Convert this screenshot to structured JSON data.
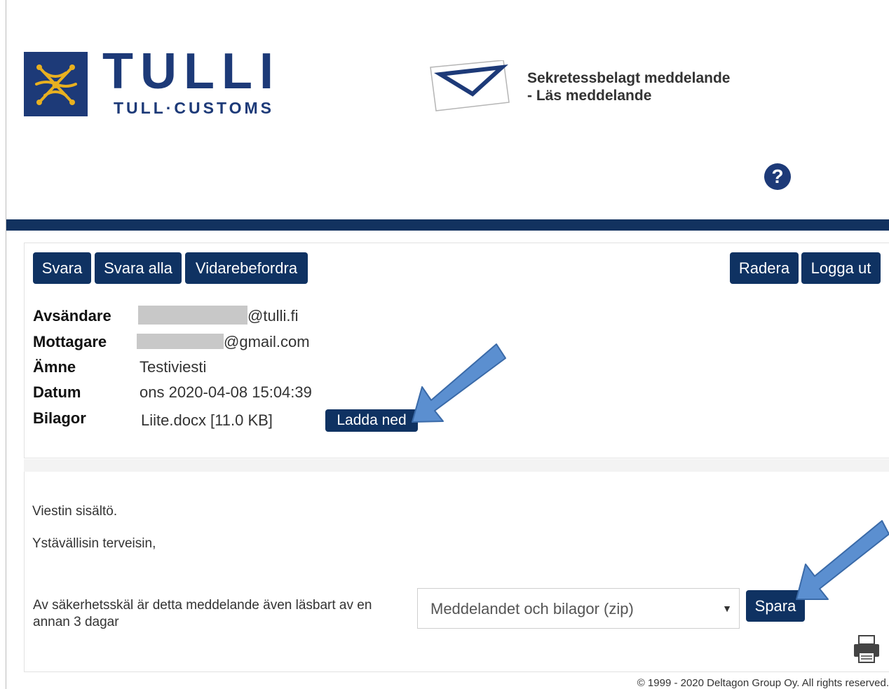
{
  "header": {
    "brand_title": "TULLI",
    "brand_subtitle": "TULL·CUSTOMS",
    "title_line1": "Sekretessbelagt meddelande",
    "title_line2": "- Läs meddelande",
    "help_label": "?"
  },
  "toolbar": {
    "reply": "Svara",
    "reply_all": "Svara alla",
    "forward": "Vidarebefordra",
    "delete": "Radera",
    "logout": "Logga ut"
  },
  "message": {
    "sender_label": "Avsändare",
    "sender_value": "@tulli.fi",
    "recipient_label": "Mottagare",
    "recipient_value": "@gmail.com",
    "subject_label": "Ämne",
    "subject_value": "Testiviesti",
    "date_label": "Datum",
    "date_value": "ons 2020-04-08 15:04:39",
    "attachments_label": "Bilagor",
    "attachment_name": "Liite.docx [11.0 KB]",
    "download_label": "Ladda ned"
  },
  "body": {
    "line1": "Viestin sisältö.",
    "line2": "Ystävällisin terveisin,"
  },
  "footer": {
    "notice": "Av säkerhetsskäl är detta meddelande även läsbart av en annan 3 dagar",
    "save_option": "Meddelandet och bilagor (zip)",
    "save_label": "Spara",
    "copyright": "© 1999 - 2020 Deltagon Group Oy. All rights reserved."
  },
  "colors": {
    "brand_navy": "#1d3a78",
    "button_navy": "#0f3262",
    "annotation_arrow": "#5b8fd0"
  }
}
